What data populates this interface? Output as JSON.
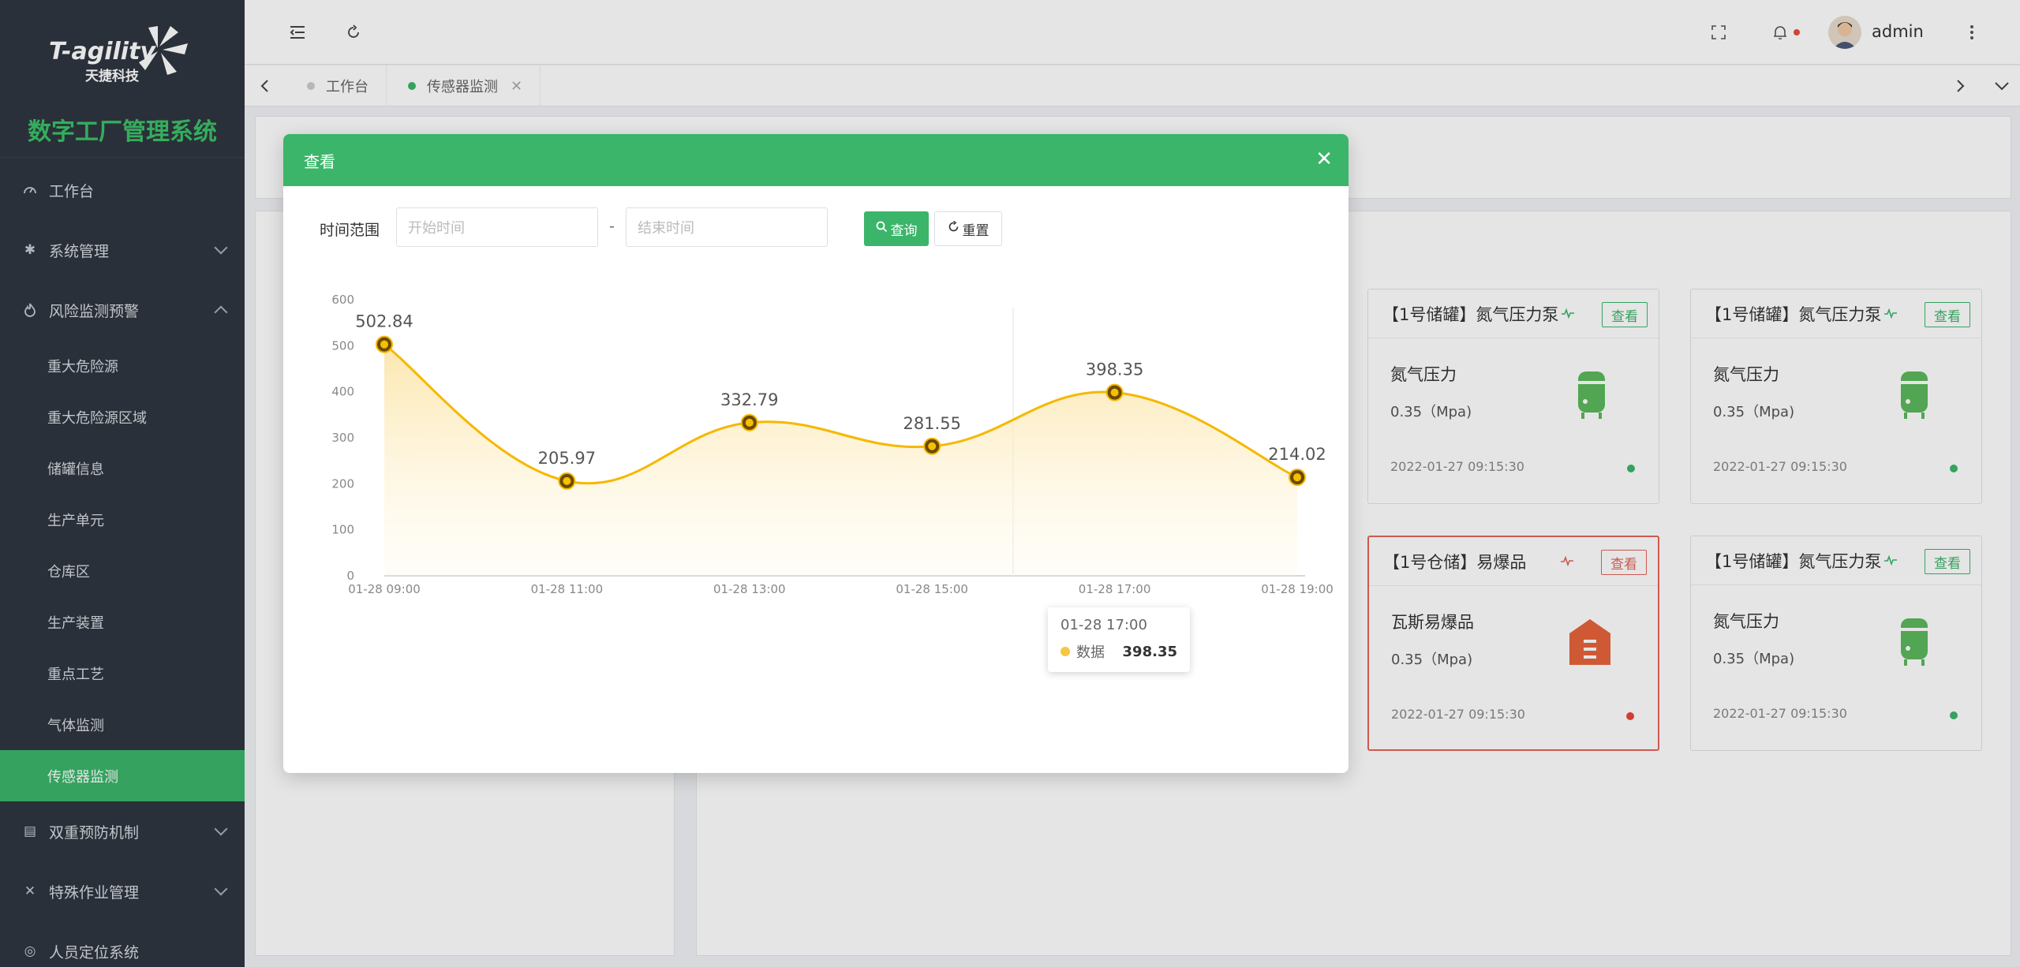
{
  "brand": {
    "logo_text": "T-agility",
    "logo_sub": "天捷科技",
    "system_name": "数字工厂管理系统"
  },
  "sidebar": {
    "items": [
      {
        "label": "工作台",
        "icon": "dashboard-icon"
      },
      {
        "label": "系统管理",
        "icon": "gear-icon"
      },
      {
        "label": "风险监测预警",
        "icon": "fire-icon"
      }
    ],
    "risk_subitems": [
      "重大危险源",
      "重大危险源区域",
      "储罐信息",
      "生产单元",
      "仓库区",
      "生产装置",
      "重点工艺",
      "气体监测",
      "传感器监测"
    ],
    "active_sub": "传感器监测",
    "lower_items": [
      {
        "label": "双重预防机制",
        "icon": "shield-icon"
      },
      {
        "label": "特殊作业管理",
        "icon": "tools-icon"
      },
      {
        "label": "人员定位系统",
        "icon": "location-icon"
      }
    ]
  },
  "header": {
    "username": "admin"
  },
  "tabs": [
    {
      "label": "工作台",
      "active": false
    },
    {
      "label": "传感器监测",
      "active": true
    }
  ],
  "cards": [
    {
      "title": "【1号储罐】氮气压力泵",
      "button": "查看",
      "metric": "氮气压力",
      "value": "0.35（Mpa)",
      "time": "2022-01-27 09:15:30",
      "status": "normal",
      "kind": "tank"
    },
    {
      "title": "【1号储罐】氮气压力泵",
      "button": "查看",
      "metric": "氮气压力",
      "value": "0.35（Mpa)",
      "time": "2022-01-27 09:15:30",
      "status": "normal",
      "kind": "tank"
    },
    {
      "title": "【1号仓储】易爆品",
      "button": "查看",
      "metric": "瓦斯易爆品",
      "value": "0.35（Mpa)",
      "time": "2022-01-27 09:15:30",
      "status": "alarm",
      "kind": "warehouse"
    },
    {
      "title": "【1号储罐】氮气压力泵",
      "button": "查看",
      "metric": "氮气压力",
      "value": "0.35（Mpa)",
      "time": "2022-01-27 09:15:30",
      "status": "normal",
      "kind": "tank"
    }
  ],
  "modal": {
    "title": "查看",
    "filter_label": "时间范围",
    "start_placeholder": "开始时间",
    "end_placeholder": "结束时间",
    "separator": "-",
    "query_label": "查询",
    "reset_label": "重置",
    "tooltip": {
      "title": "01-28 17:00",
      "series": "数据",
      "value": "398.35"
    }
  },
  "colors": {
    "accent": "#3bb56a",
    "sidebar_bg": "#2f3640",
    "alarm": "#e5645a",
    "line": "#f5b800"
  },
  "chart_data": {
    "type": "area",
    "categories": [
      "01-28 09:00",
      "01-28 11:00",
      "01-28 13:00",
      "01-28 15:00",
      "01-28 17:00",
      "01-28 19:00"
    ],
    "series": [
      {
        "name": "数据",
        "values": [
          502.84,
          205.97,
          332.79,
          281.55,
          398.35,
          214.02
        ]
      }
    ],
    "yticks": [
      0,
      100,
      200,
      300,
      400,
      500,
      600
    ],
    "ylim": [
      0,
      600
    ],
    "smooth": true,
    "data_labels": true,
    "grid": false
  }
}
